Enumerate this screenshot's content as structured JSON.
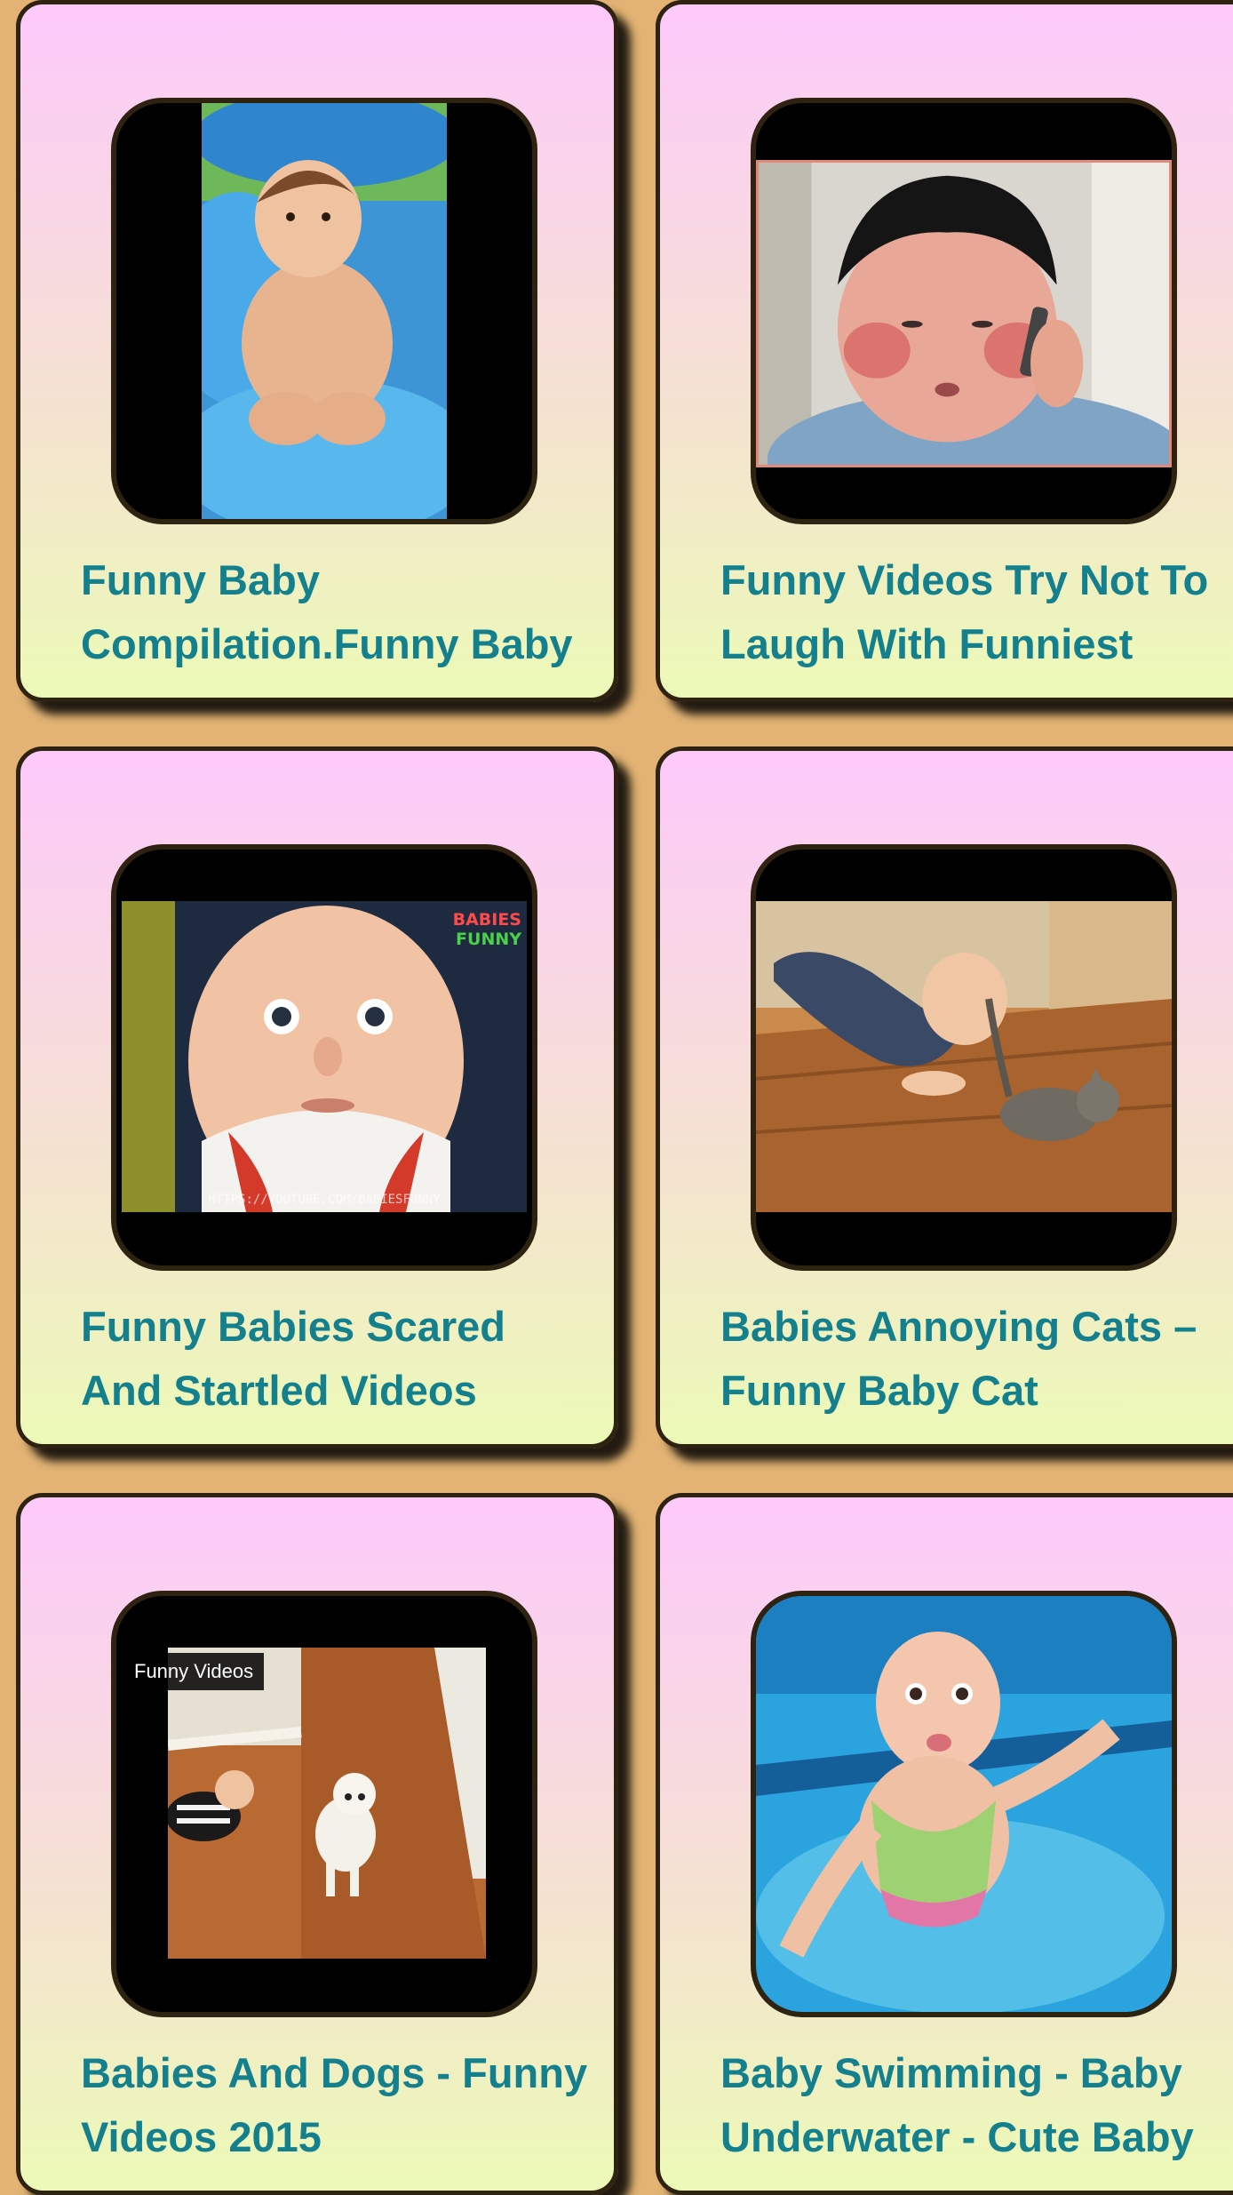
{
  "videos": [
    {
      "title": "Funny Baby\nCompilation.Funny Baby",
      "thumbnail_icon": "baby-in-pool-photo"
    },
    {
      "title": "Funny Videos Try Not To\nLaugh With Funniest",
      "thumbnail_icon": "chubby-kid-on-phone-photo"
    },
    {
      "title": "Funny Babies Scared\nAnd Startled Videos",
      "thumbnail_icon": "startled-baby-face-photo",
      "watermark_line1": "BABIES",
      "watermark_line2": "FUNNY",
      "watermark_url": "HTTPS://YOUTUBE.COM/BABIESFUNNY"
    },
    {
      "title": "Babies Annoying Cats –\nFunny Baby Cat",
      "thumbnail_icon": "baby-chasing-kitten-photo"
    },
    {
      "title": "Babies And Dogs - Funny\nVideos 2015",
      "thumbnail_icon": "baby-and-puppy-photo",
      "overlay_label": "Funny Videos"
    },
    {
      "title": "Baby Swimming - Baby\nUnderwater - Cute Baby",
      "thumbnail_icon": "baby-underwater-photo"
    }
  ],
  "colors": {
    "page_background": "#e2b373",
    "card_border": "#2e2210",
    "card_gradient_top": "#fdc9fb",
    "card_gradient_bottom": "#ecfab7",
    "title_text": "#15808d"
  }
}
